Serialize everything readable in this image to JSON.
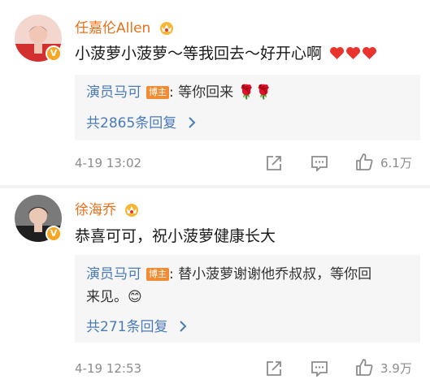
{
  "comments": [
    {
      "username": "任嘉伦Allen",
      "text": "小菠萝小菠萝～等我回去～好开心啊",
      "reply": {
        "author": "演员马可",
        "tag": "博主",
        "lines": [
          ": 等你回来 🌹🌹"
        ],
        "more": "共2865条回复"
      },
      "time": "4-19 13:02",
      "likes": "6.1万"
    },
    {
      "username": "徐海乔",
      "text": "恭喜可可，祝小菠萝健康长大",
      "reply": {
        "author": "演员马可",
        "tag": "博主",
        "lines": [
          ": 替小菠萝谢谢他乔叔叔，等你回",
          "来见。😊"
        ],
        "more": "共271条回复"
      },
      "time": "4-19 12:53",
      "likes": "3.9万"
    }
  ],
  "icons": {
    "verified": "v-badge-icon",
    "crown": "crown-icon",
    "share": "share-icon",
    "comment": "comment-icon",
    "like": "thumbs-up-icon",
    "chevron": "chevron-right-icon",
    "heart": "heart-icon"
  },
  "colors": {
    "username": "#e8711a",
    "link": "#4a7bb7",
    "tag": "#f08c33",
    "verified": "#f5a623",
    "heart": "#e8342c",
    "meta": "#8c8c8c"
  }
}
